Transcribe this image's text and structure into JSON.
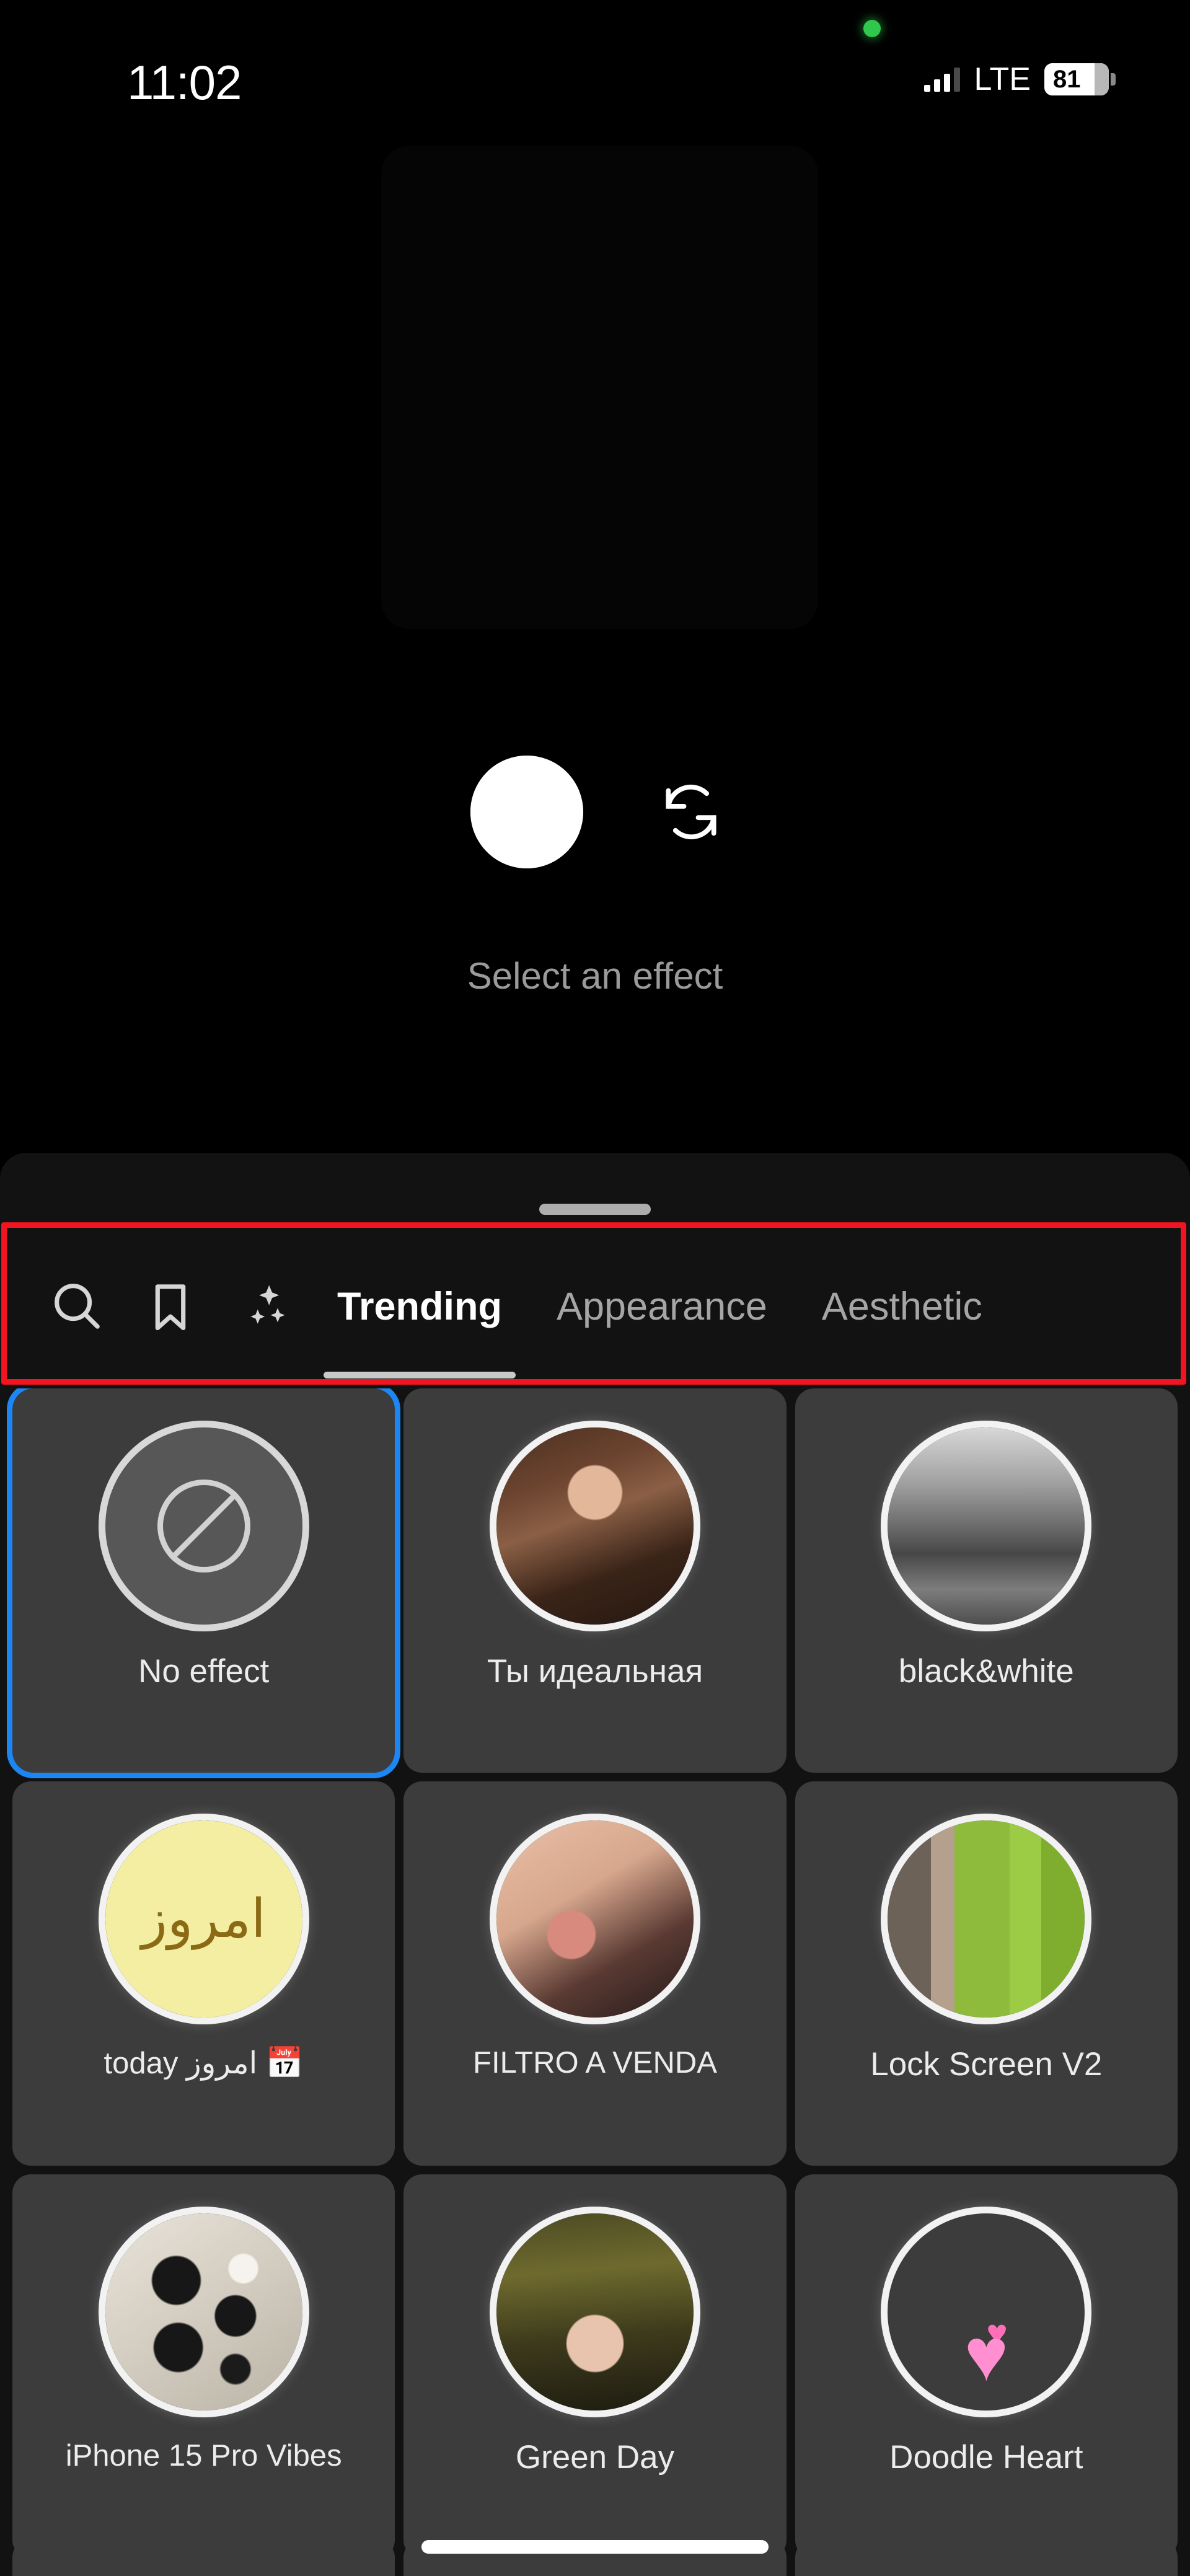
{
  "status_bar": {
    "time": "11:02",
    "network_label": "LTE",
    "battery_level": "81",
    "signal_bars_filled": 3,
    "signal_bars_total": 4,
    "privacy_indicator": "camera-in-use-green-dot"
  },
  "preview": {
    "hint_text": "Select an effect",
    "shutter_icon": "shutter-circle",
    "flip_camera_icon": "camera-flip-icon"
  },
  "panel": {
    "drag_handle": "drag-handle",
    "icon_tabs": [
      {
        "name": "search-icon",
        "glyph": "search"
      },
      {
        "name": "bookmark-icon",
        "glyph": "bookmark"
      },
      {
        "name": "sparkles-icon",
        "glyph": "sparkles"
      }
    ],
    "tabs": [
      {
        "label": "Trending",
        "active": true
      },
      {
        "label": "Appearance",
        "active": false
      },
      {
        "label": "Aesthetic",
        "active": false
      }
    ],
    "annotation": {
      "color": "#f01520",
      "target": "effect-category-tab-bar"
    }
  },
  "effects": [
    {
      "label": "No effect",
      "art": "noeffect",
      "selected": true,
      "small": false
    },
    {
      "label": "Ты идеальная",
      "art": "portrait1",
      "selected": false,
      "small": false
    },
    {
      "label": "black&white",
      "art": "bw",
      "selected": false,
      "small": false
    },
    {
      "label": "today امروز 📅",
      "art": "yellow",
      "selected": false,
      "small": true,
      "circle_text": "امروز"
    },
    {
      "label": "FILTRO A VENDA",
      "art": "portrait2",
      "selected": false,
      "small": true
    },
    {
      "label": "Lock Screen V2",
      "art": "lockscreen",
      "selected": false,
      "small": false
    },
    {
      "label": "iPhone 15 Pro Vibes",
      "art": "iphone",
      "selected": false,
      "small": true
    },
    {
      "label": "Green Day",
      "art": "greenday",
      "selected": false,
      "small": false
    },
    {
      "label": "Doodle Heart",
      "art": "doodle",
      "selected": false,
      "small": false
    }
  ],
  "selection_color": "#1d86f5",
  "panel_background": "#121212",
  "cell_background": "#3c3c3c"
}
